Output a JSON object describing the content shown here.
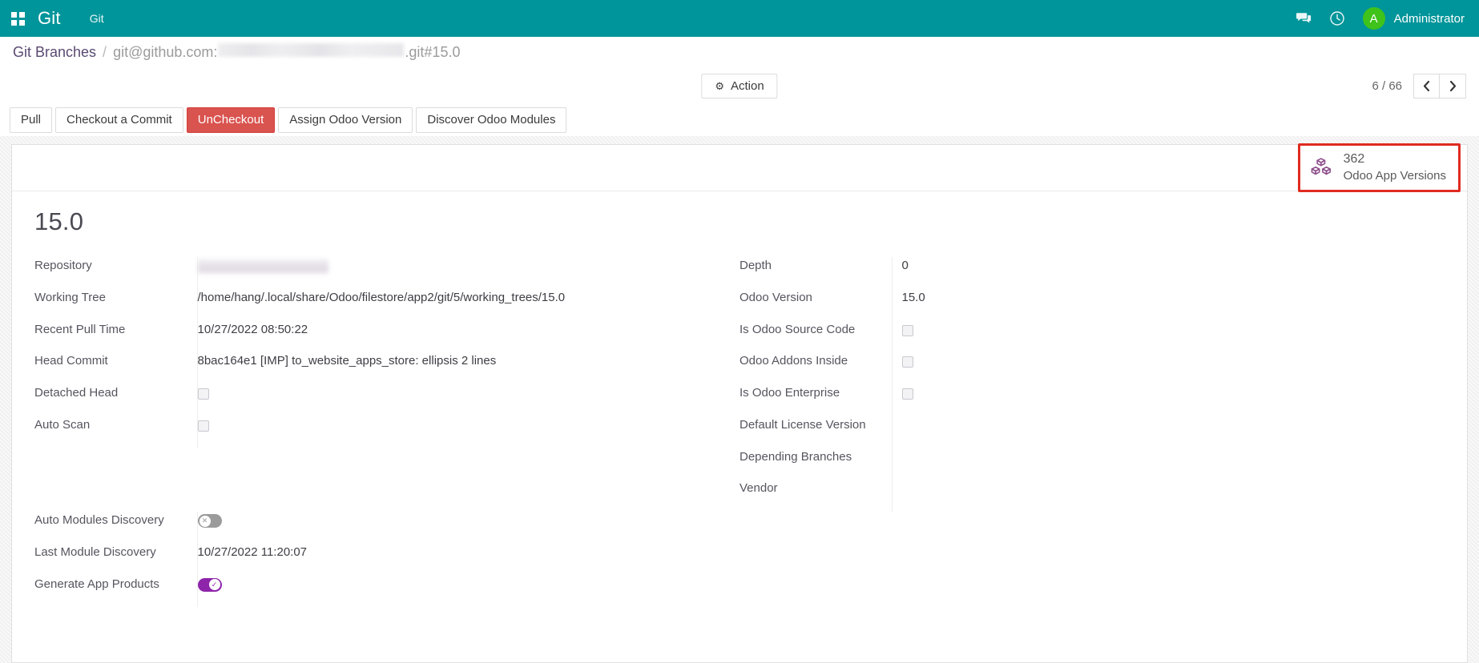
{
  "colors": {
    "navbar": "#00959a",
    "accent_purple": "#8e24aa",
    "danger_red": "#d9534f",
    "highlight_red": "#e02b20",
    "avatar_green": "#3fc21a",
    "stat_icon_purple": "#8f4f8c"
  },
  "navbar": {
    "apps_icon": "apps-grid-icon",
    "brand": "Git",
    "menu_item": "Git",
    "messaging_icon": "messaging-icon",
    "activity_icon": "activity-clock-icon",
    "avatar_initial": "A",
    "username": "Administrator"
  },
  "breadcrumb": {
    "root": "Git Branches",
    "separator": "/",
    "current_prefix": "git@github.com:",
    "current_redacted": "",
    "current_suffix": ".git#15.0"
  },
  "control_panel": {
    "action_label": "Action",
    "gear_icon": "gear-icon",
    "pager_text": "6 / 66",
    "prev_icon": "chevron-left-icon",
    "next_icon": "chevron-right-icon"
  },
  "statusbar": {
    "buttons": [
      {
        "label": "Pull",
        "style": "default"
      },
      {
        "label": "Checkout a Commit",
        "style": "default"
      },
      {
        "label": "UnCheckout",
        "style": "danger"
      },
      {
        "label": "Assign Odoo Version",
        "style": "default"
      },
      {
        "label": "Discover Odoo Modules",
        "style": "default"
      }
    ]
  },
  "stat_button": {
    "icon": "cubes-icon",
    "value": "362",
    "label": "Odoo App Versions",
    "highlighted": true
  },
  "record": {
    "title": "15.0",
    "left_fields": [
      {
        "label": "Repository",
        "type": "redacted",
        "value": ""
      },
      {
        "label": "Working Tree",
        "type": "text",
        "value": "/home/hang/.local/share/Odoo/filestore/app2/git/5/working_trees/15.0"
      },
      {
        "label": "Recent Pull Time",
        "type": "text",
        "value": "10/27/2022 08:50:22"
      },
      {
        "label": "Head Commit",
        "type": "text",
        "value": "8bac164e1 [IMP] to_website_apps_store: ellipsis 2 lines"
      },
      {
        "label": "Detached Head",
        "type": "checkbox",
        "value": false
      },
      {
        "label": "Auto Scan",
        "type": "checkbox",
        "value": false
      }
    ],
    "right_fields": [
      {
        "label": "Depth",
        "type": "text",
        "value": "0"
      },
      {
        "label": "Odoo Version",
        "type": "text",
        "value": "15.0"
      },
      {
        "label": "Is Odoo Source Code",
        "type": "checkbox",
        "value": false
      },
      {
        "label": "Odoo Addons Inside",
        "type": "checkbox",
        "value": false
      },
      {
        "label": "Is Odoo Enterprise",
        "type": "checkbox",
        "value": false
      },
      {
        "label": "Default License Version",
        "type": "text",
        "value": ""
      },
      {
        "label": "Depending Branches",
        "type": "text",
        "value": ""
      },
      {
        "label": "Vendor",
        "type": "text",
        "value": ""
      }
    ],
    "bottom_fields": [
      {
        "label": "Auto Modules Discovery",
        "type": "toggle",
        "value": false,
        "glyph": "✕"
      },
      {
        "label": "Last Module Discovery",
        "type": "text",
        "value": "10/27/2022 11:20:07"
      },
      {
        "label": "Generate App Products",
        "type": "toggle",
        "value": true,
        "glyph": "✓"
      }
    ]
  }
}
